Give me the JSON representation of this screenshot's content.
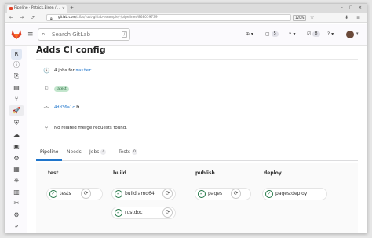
{
  "browser": {
    "tab_title": "Pipeline · Patrick.Elsen / …",
    "tab_close": "×",
    "new_tab": "+",
    "window_controls": "– ▢ ×",
    "back": "←",
    "forward": "→",
    "reload": "⟳",
    "url_host": "gitlab.com",
    "url_path": "/xfbs/rust-gitlab-example/-/pipelines/868059739",
    "zoom": "120%",
    "bookmark": "☆",
    "right_icons": "⬇ ≡"
  },
  "header": {
    "search_placeholder": "Search GitLab",
    "search_shortcut": "/",
    "create_icon": "⊕ ▾",
    "issues_icon": "▢",
    "issues_count": "5",
    "mr_icon": "⑂",
    "mr_count": "8",
    "todo_icon": "☑",
    "help_icon": "? ▾",
    "avatar_caret": "▾"
  },
  "sidebar": {
    "project_initial": "R",
    "icons": [
      "ⓘ",
      "⎘",
      "▤",
      "⑂",
      "🚀",
      "⛨",
      "☁",
      "▣",
      "⚙",
      "▦",
      "⎈",
      "▥",
      "✂",
      "⚙",
      "»"
    ]
  },
  "pipeline": {
    "title": "Adds CI config",
    "jobs_count_text": "4 jobs for",
    "branch": "master",
    "tag": "latest",
    "commit": "4dd36a1c",
    "copy_icon": "⧉",
    "mr_text": "No related merge requests found.",
    "clock_icon": "🕓",
    "flag_icon": "⚐",
    "commit_icon": "-o-",
    "mr_icon": "⑂"
  },
  "tabs": [
    {
      "label": "Pipeline",
      "count": ""
    },
    {
      "label": "Needs",
      "count": ""
    },
    {
      "label": "Jobs",
      "count": "4"
    },
    {
      "label": "Tests",
      "count": "0"
    }
  ],
  "stages": [
    {
      "name": "test",
      "jobs": [
        "tests"
      ]
    },
    {
      "name": "build",
      "jobs": [
        "build:amd64",
        "rustdoc"
      ]
    },
    {
      "name": "publish",
      "jobs": [
        "pages"
      ]
    },
    {
      "name": "deploy",
      "jobs": [
        "pages:deploy"
      ]
    }
  ],
  "icons": {
    "check": "✓",
    "retry": "⟳"
  },
  "colors": {
    "success": "#217645",
    "link": "#1f75cb",
    "tag_bg": "#c3e6cd",
    "gitlab_orange": "#e24329"
  }
}
